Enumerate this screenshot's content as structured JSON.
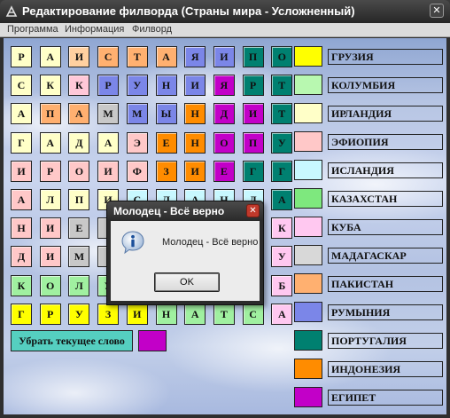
{
  "window": {
    "title": "Редактирование филворда (Страны мира - Усложненный)",
    "close_glyph": "✕",
    "app_icon": "fillword-app-icon"
  },
  "menu": {
    "items": [
      "Программа",
      "Информация",
      "Филворд"
    ]
  },
  "grid": {
    "rows": [
      [
        {
          "l": "Р",
          "c": "#ffffc8"
        },
        {
          "l": "А",
          "c": "#ffffc8"
        },
        {
          "l": "И",
          "c": "#ffd0a0"
        },
        {
          "l": "С",
          "c": "#ffb070"
        },
        {
          "l": "Т",
          "c": "#ffb070"
        },
        {
          "l": "А",
          "c": "#ffb070"
        },
        {
          "l": "Я",
          "c": "#7b86e8"
        },
        {
          "l": "И",
          "c": "#7b86e8"
        },
        {
          "l": "П",
          "c": "#008070"
        },
        {
          "l": "О",
          "c": "#008070"
        }
      ],
      [
        {
          "l": "С",
          "c": "#ffffc8"
        },
        {
          "l": "К",
          "c": "#ffffc8"
        },
        {
          "l": "К",
          "c": "#ffc8d8"
        },
        {
          "l": "Р",
          "c": "#7b86e8"
        },
        {
          "l": "У",
          "c": "#7b86e8"
        },
        {
          "l": "Н",
          "c": "#7b86e8"
        },
        {
          "l": "И",
          "c": "#7b86e8"
        },
        {
          "l": "Я",
          "c": "#c200c8"
        },
        {
          "l": "Р",
          "c": "#008070"
        },
        {
          "l": "Т",
          "c": "#008070"
        }
      ],
      [
        {
          "l": "А",
          "c": "#ffffc8"
        },
        {
          "l": "П",
          "c": "#ffb070"
        },
        {
          "l": "А",
          "c": "#ffb070"
        },
        {
          "l": "М",
          "c": "#c8c8c8"
        },
        {
          "l": "М",
          "c": "#7b86e8"
        },
        {
          "l": "Ы",
          "c": "#7b86e8"
        },
        {
          "l": "Н",
          "c": "#ff8c00"
        },
        {
          "l": "Д",
          "c": "#c200c8"
        },
        {
          "l": "И",
          "c": "#c200c8"
        },
        {
          "l": "Т",
          "c": "#008070"
        }
      ],
      [
        {
          "l": "Г",
          "c": "#ffffc8"
        },
        {
          "l": "А",
          "c": "#ffffc8"
        },
        {
          "l": "Д",
          "c": "#ffffc8"
        },
        {
          "l": "А",
          "c": "#ffffc8"
        },
        {
          "l": "Э",
          "c": "#ffc8c8"
        },
        {
          "l": "Е",
          "c": "#ff8c00"
        },
        {
          "l": "Н",
          "c": "#ff8c00"
        },
        {
          "l": "О",
          "c": "#c200c8"
        },
        {
          "l": "П",
          "c": "#c200c8"
        },
        {
          "l": "У",
          "c": "#008070"
        }
      ],
      [
        {
          "l": "И",
          "c": "#ffc8c8"
        },
        {
          "l": "Р",
          "c": "#ffc8c8"
        },
        {
          "l": "О",
          "c": "#ffc8c8"
        },
        {
          "l": "И",
          "c": "#ffc8c8"
        },
        {
          "l": "Ф",
          "c": "#ffc8c8"
        },
        {
          "l": "З",
          "c": "#ff8c00"
        },
        {
          "l": "И",
          "c": "#ff8c00"
        },
        {
          "l": "Е",
          "c": "#c200c8"
        },
        {
          "l": "Г",
          "c": "#008070"
        },
        {
          "l": "Г",
          "c": "#008070"
        }
      ],
      [
        {
          "l": "А",
          "c": "#ffc8c8"
        },
        {
          "l": "Л",
          "c": "#ffffc8"
        },
        {
          "l": "П",
          "c": "#ffffc8"
        },
        {
          "l": "И",
          "c": "#ffffc8"
        },
        {
          "l": "С",
          "c": "#c8f8ff"
        },
        {
          "l": "Л",
          "c": "#c8f8ff"
        },
        {
          "l": "А",
          "c": "#c8f8ff"
        },
        {
          "l": "Н",
          "c": "#c8f8ff"
        },
        {
          "l": "Д",
          "c": "#c8f8ff"
        },
        {
          "l": "А",
          "c": "#008070"
        }
      ],
      [
        {
          "l": "Н",
          "c": "#ffc8c8"
        },
        {
          "l": "И",
          "c": "#ffc8c8"
        },
        {
          "l": "Е",
          "c": "#c8c8c8"
        },
        {
          "l": "",
          "c": "#c8c8c8"
        },
        {
          "l": "",
          "c": "#c8c8c8"
        },
        {
          "l": "",
          "c": "#c8c8c8"
        },
        {
          "l": "",
          "c": "#c8c8c8"
        },
        {
          "l": "",
          "c": "#c8c8c8"
        },
        {
          "l": "",
          "c": "#c8c8c8"
        },
        {
          "l": "К",
          "c": "#ffc8f0"
        }
      ],
      [
        {
          "l": "Д",
          "c": "#ffc8c8"
        },
        {
          "l": "И",
          "c": "#ffc8c8"
        },
        {
          "l": "М",
          "c": "#c8c8c8"
        },
        {
          "l": "",
          "c": "#c8c8c8"
        },
        {
          "l": "",
          "c": "#c8c8c8"
        },
        {
          "l": "",
          "c": "#c8c8c8"
        },
        {
          "l": "",
          "c": "#c8c8c8"
        },
        {
          "l": "",
          "c": "#c8c8c8"
        },
        {
          "l": "",
          "c": "#c8c8c8"
        },
        {
          "l": "У",
          "c": "#ffc8f0"
        }
      ],
      [
        {
          "l": "К",
          "c": "#a0f0a0"
        },
        {
          "l": "О",
          "c": "#a0f0a0"
        },
        {
          "l": "Л",
          "c": "#a0f0a0"
        },
        {
          "l": "У",
          "c": "#a0f0a0"
        },
        {
          "l": "",
          "c": "#c8c8c8"
        },
        {
          "l": "",
          "c": "#c8c8c8"
        },
        {
          "l": "",
          "c": "#c8c8c8"
        },
        {
          "l": "",
          "c": "#c8c8c8"
        },
        {
          "l": "",
          "c": "#c8c8c8"
        },
        {
          "l": "Б",
          "c": "#ffc8f0"
        }
      ],
      [
        {
          "l": "Г",
          "c": "#ffff00"
        },
        {
          "l": "Р",
          "c": "#ffff00"
        },
        {
          "l": "У",
          "c": "#ffff00"
        },
        {
          "l": "З",
          "c": "#ffff00"
        },
        {
          "l": "И",
          "c": "#ffff00"
        },
        {
          "l": "Н",
          "c": "#a0f0a0"
        },
        {
          "l": "А",
          "c": "#a0f0a0"
        },
        {
          "l": "Т",
          "c": "#a0f0a0"
        },
        {
          "l": "С",
          "c": "#a0f0a0"
        },
        {
          "l": "А",
          "c": "#ffc8f0"
        }
      ]
    ]
  },
  "words": [
    {
      "name": "ГРУЗИЯ",
      "color": "#ffff00"
    },
    {
      "name": "КОЛУМБИЯ",
      "color": "#b8f8b0"
    },
    {
      "name": "ИРЛАНДИЯ",
      "color": "#ffffc8"
    },
    {
      "name": "ЭФИОПИЯ",
      "color": "#ffc8c8"
    },
    {
      "name": "ИСЛАНДИЯ",
      "color": "#c8f8ff"
    },
    {
      "name": "КАЗАХСТАН",
      "color": "#7ee87e"
    },
    {
      "name": "КУБА",
      "color": "#ffc8f0"
    },
    {
      "name": "МАДАГАСКАР",
      "color": "#d8d8d8"
    },
    {
      "name": "ПАКИСТАН",
      "color": "#ffb070"
    },
    {
      "name": "РУМЫНИЯ",
      "color": "#7b86e8"
    },
    {
      "name": "ПОРТУГАЛИЯ",
      "color": "#008070"
    },
    {
      "name": "ИНДОНЕЗИЯ",
      "color": "#ff8c00"
    },
    {
      "name": "ЕГИПЕТ",
      "color": "#c200c8"
    }
  ],
  "controls": {
    "remove_word_label": "Убрать текущее слово",
    "current_color": "#c200c8"
  },
  "dialog": {
    "title": "Молодец - Всё верно",
    "message": "Молодец - Всё верно",
    "ok_label": "OK",
    "close_glyph": "✕",
    "icon": "info-icon"
  }
}
